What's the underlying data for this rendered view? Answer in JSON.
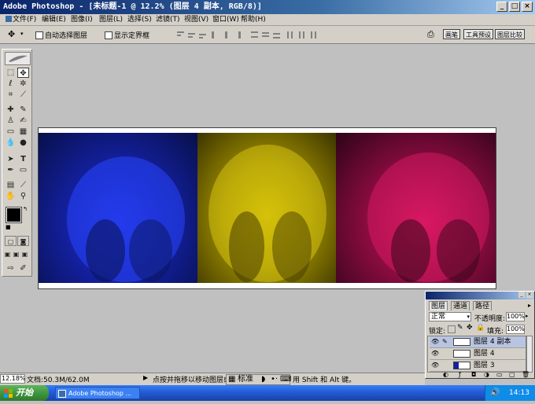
{
  "window": {
    "title": "Adobe Photoshop - [未标题-1 @ 12.2% (图层 4 副本, RGB/8)]",
    "buttons": [
      "_",
      "□",
      "×"
    ]
  },
  "menu": [
    "文件(F)",
    "编辑(E)",
    "图像(I)",
    "图层(L)",
    "选择(S)",
    "滤镜(T)",
    "视图(V)",
    "窗口(W)",
    "帮助(H)"
  ],
  "options": {
    "auto_select_layer": "自动选择图层",
    "show_bounding_box": "显示定界框",
    "palette_tabs": [
      "画笔",
      "工具预设",
      "图层比较"
    ]
  },
  "layers_panel": {
    "tabs": [
      "图层",
      "通道",
      "路径"
    ],
    "blend_mode": "正常",
    "opacity_label": "不透明度:",
    "opacity_value": "100%",
    "lock_label": "锁定:",
    "fill_label": "填充:",
    "fill_value": "100%",
    "layers": [
      {
        "name": "图层 4 副本",
        "selected": true
      },
      {
        "name": "图层 4",
        "selected": false
      },
      {
        "name": "图层 3",
        "selected": false
      }
    ]
  },
  "status": {
    "zoom": "12.18%",
    "doc_info": "文档:50.3M/62.0M",
    "hint": "点按并拖移以移动图层或",
    "hint_tail": "用 Shift 和 Alt 键。"
  },
  "ime": {
    "mode": "标准"
  },
  "taskbar": {
    "start": "开始",
    "task": "Adobe Photoshop ...",
    "clock": "14:13"
  },
  "colors": {
    "panel_blue": "#1420a0",
    "panel_yellow": "#9a8a00",
    "panel_pink": "#8c0c40",
    "titlebar": "#0a246a"
  }
}
